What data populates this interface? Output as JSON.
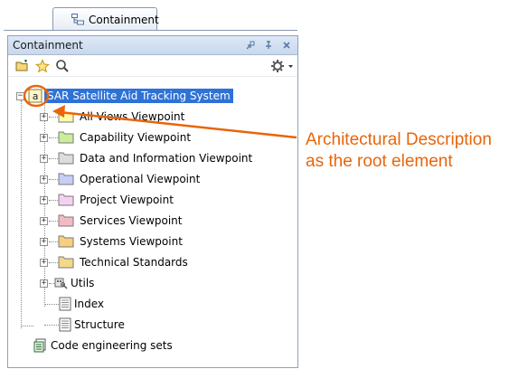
{
  "outer_tab": {
    "label": "Containment",
    "icon": "containment-tree-icon"
  },
  "panel": {
    "title": "Containment",
    "header_buttons": [
      "restore-icon",
      "pin-icon",
      "close-icon"
    ],
    "toolbar": [
      "new-folder-icon",
      "favorite-star-icon",
      "search-icon",
      "settings-gear-icon"
    ]
  },
  "tree": {
    "root": {
      "badge": "a",
      "label": "SAR Satellite Aid Tracking System",
      "icon": "architectural-description-icon"
    },
    "items": [
      {
        "label": "All Views Viewpoint",
        "color": "#fff9a8",
        "icon": "folder-icon"
      },
      {
        "label": "Capability Viewpoint",
        "color": "#c9ed9a",
        "icon": "folder-icon"
      },
      {
        "label": "Data and Information Viewpoint",
        "color": "#dcdcdc",
        "icon": "folder-icon"
      },
      {
        "label": "Operational Viewpoint",
        "color": "#c6cdf6",
        "icon": "folder-icon"
      },
      {
        "label": "Project Viewpoint",
        "color": "#f4d2ef",
        "icon": "folder-icon"
      },
      {
        "label": "Services Viewpoint",
        "color": "#f3b9c4",
        "icon": "folder-icon"
      },
      {
        "label": "Systems Viewpoint",
        "color": "#f7cf7f",
        "icon": "folder-icon"
      },
      {
        "label": "Technical Standards",
        "color": "#f2d889",
        "icon": "folder-icon"
      },
      {
        "label": "Utils",
        "icon": "utils-package-icon"
      },
      {
        "label": "Index",
        "icon": "document-icon"
      },
      {
        "label": "Structure",
        "icon": "document-icon"
      }
    ],
    "footer_item": {
      "label": "Code engineering sets",
      "icon": "code-engineering-sets-icon"
    }
  },
  "annotation": {
    "line1": "Architectural Description",
    "line2": "as the root element",
    "color": "#e8650a"
  }
}
